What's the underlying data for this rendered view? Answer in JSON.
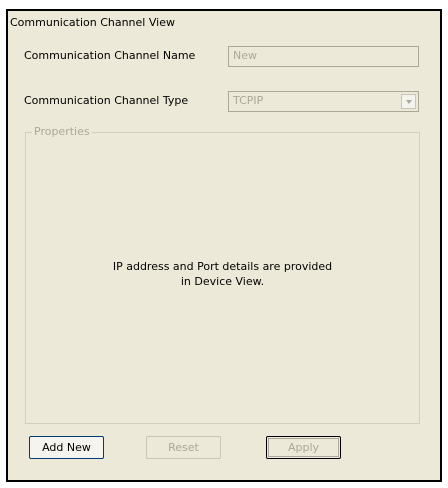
{
  "panel": {
    "title": "Communication Channel View",
    "name_label": "Communication Channel Name",
    "name_value": "New",
    "type_label": "Communication Channel Type",
    "type_value": "TCPIP",
    "properties_label": "Properties",
    "message_line1": "IP address and Port details are provided",
    "message_line2": "in Device View."
  },
  "buttons": {
    "add_new": "Add New",
    "reset": "Reset",
    "apply": "Apply"
  }
}
